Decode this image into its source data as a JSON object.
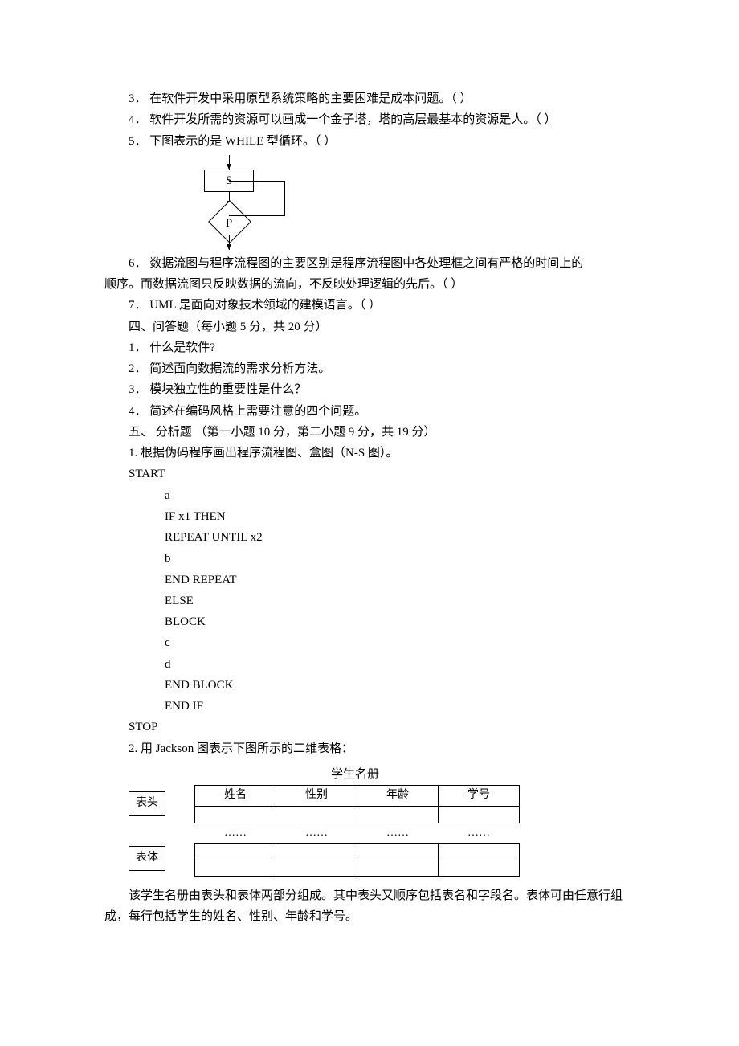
{
  "q3": "3．  在软件开发中采用原型系统策略的主要困难是成本问题。（   ）",
  "q4": "4．  软件开发所需的资源可以画成一个金子塔，塔的高层最基本的资源是人。（   ）",
  "q5": "5．  下图表示的是 WHILE 型循环。（   ）",
  "flow": {
    "box": "S",
    "diamond": "P"
  },
  "q6a": "6．  数据流图与程序流程图的主要区别是程序流程图中各处理框之间有严格的时间上的",
  "q6b": "顺序。而数据流图只反映数据的流向，不反映处理逻辑的先后。（   ）",
  "q7": "7．  UML 是面向对象技术领域的建模语言。（   ）",
  "sec4": "四、问答题（每小题 5 分，共 20 分）",
  "s4_1": "1．  什么是软件?",
  "s4_2": "2．  简述面向数据流的需求分析方法。",
  "s4_3": "3．  模块独立性的重要性是什么？",
  "s4_4": "4．  简述在编码风格上需要注意的四个问题。",
  "sec5": "五、  分析题   （第一小题 10 分，第二小题 9 分，共 19 分）",
  "s5_1": "1.  根据伪码程序画出程序流程图、盒图（N-S 图）。",
  "code": [
    "START",
    "a",
    "IF x1 THEN",
    "REPEAT UNTIL x2",
    "b",
    "END REPEAT",
    "ELSE",
    "BLOCK",
    "c",
    "d",
    "END BLOCK",
    "END IF",
    "STOP"
  ],
  "s5_2": "2.  用 Jackson 图表示下图所示的二维表格：",
  "roster": {
    "title": "学生名册",
    "label_head": "表头",
    "label_body": "表体",
    "headers": [
      "姓名",
      "性别",
      "年龄",
      "学号"
    ],
    "ellipsis": "……"
  },
  "desc": "该学生名册由表头和表体两部分组成。其中表头又顺序包括表名和字段名。表体可由任意行组成，每行包括学生的姓名、性别、年龄和学号。"
}
